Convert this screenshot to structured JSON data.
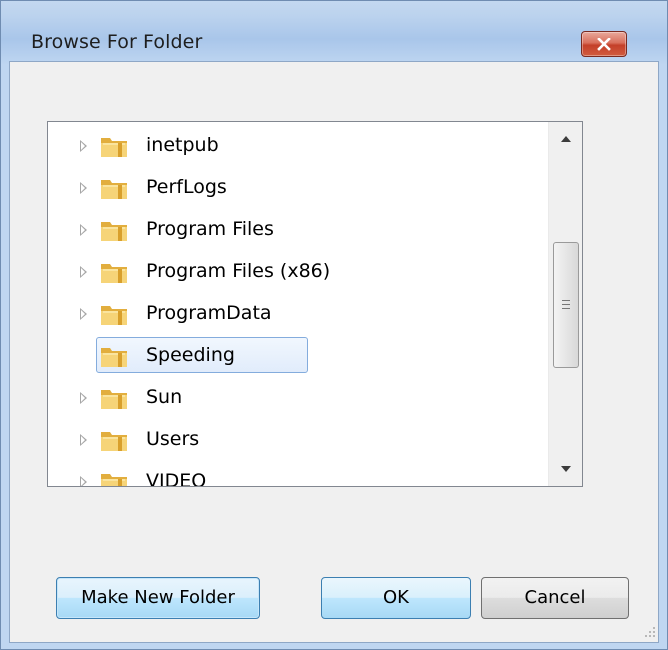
{
  "dialog": {
    "title": "Browse For Folder"
  },
  "tree": {
    "items": [
      {
        "label": "inetpub",
        "expandable": true,
        "selected": false
      },
      {
        "label": "PerfLogs",
        "expandable": true,
        "selected": false
      },
      {
        "label": "Program Files",
        "expandable": true,
        "selected": false
      },
      {
        "label": "Program Files (x86)",
        "expandable": true,
        "selected": false
      },
      {
        "label": "ProgramData",
        "expandable": true,
        "selected": false
      },
      {
        "label": "Speeding",
        "expandable": false,
        "selected": true
      },
      {
        "label": "Sun",
        "expandable": true,
        "selected": false
      },
      {
        "label": "Users",
        "expandable": true,
        "selected": false
      },
      {
        "label": "VIDEO",
        "expandable": true,
        "selected": false
      }
    ]
  },
  "buttons": {
    "make_new_folder": "Make New Folder",
    "ok": "OK",
    "cancel": "Cancel"
  },
  "colors": {
    "title_bar": "#bcd3ee",
    "close_button": "#c4402a",
    "selection_border": "#84acdd",
    "folder": "#e8b84a"
  },
  "icons": {
    "close": "close-icon",
    "folder": "folder-icon",
    "expander": "expand-triangle-icon"
  }
}
